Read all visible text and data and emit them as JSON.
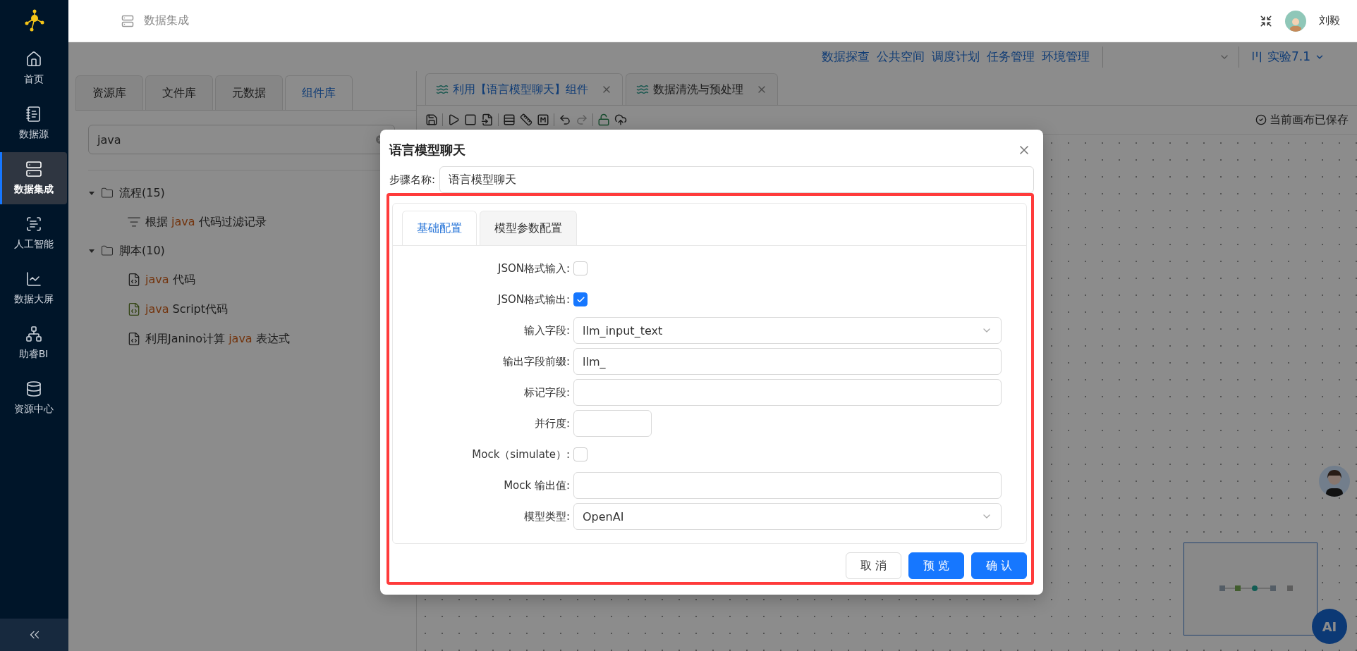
{
  "sidebar": {
    "items": [
      {
        "label": "首页",
        "selected": false
      },
      {
        "label": "数据源",
        "selected": false
      },
      {
        "label": "数据集成",
        "selected": true
      },
      {
        "label": "人工智能",
        "selected": false
      },
      {
        "label": "数据大屏",
        "selected": false
      },
      {
        "label": "助睿BI",
        "selected": false
      },
      {
        "label": "资源中心",
        "selected": false
      }
    ]
  },
  "header": {
    "title": "数据集成",
    "user": "刘毅"
  },
  "nav": {
    "links": [
      "数据探查",
      "公共空间",
      "调度计划",
      "任务管理",
      "环境管理"
    ],
    "project": "实验7.1"
  },
  "left_panel": {
    "tabs": [
      {
        "label": "资源库",
        "selected": false
      },
      {
        "label": "文件库",
        "selected": false
      },
      {
        "label": "元数据",
        "selected": false
      },
      {
        "label": "组件库",
        "selected": true
      }
    ],
    "search": {
      "value": "java"
    },
    "tree": [
      {
        "label": "流程(15)",
        "expanded": true,
        "children": [
          {
            "kind": "filter",
            "prefix": "根据 ",
            "match": "java",
            "suffix": " 代码过滤记录"
          }
        ]
      },
      {
        "label": "脚本(10)",
        "expanded": true,
        "children": [
          {
            "kind": "script",
            "match": "java",
            "suffix": " 代码"
          },
          {
            "kind": "js",
            "match": "java",
            "suffix": " Script代码"
          },
          {
            "kind": "script",
            "prefix": "利用Janino计算 ",
            "match": "java",
            "suffix": " 表达式"
          }
        ]
      }
    ]
  },
  "editor": {
    "tabs": [
      {
        "label": "利用【语言模型聊天】组件",
        "selected": true
      },
      {
        "label": "数据清洗与预处理",
        "selected": false
      }
    ],
    "status": "当前画布已保存",
    "ai_button": "AI"
  },
  "dialog": {
    "title": "语言模型聊天",
    "step_name_label": "步骤名称:",
    "step_name": "语言模型聊天",
    "tabs": [
      {
        "label": "基础配置",
        "selected": true
      },
      {
        "label": "模型参数配置",
        "selected": false
      }
    ],
    "fields": [
      {
        "kind": "checkbox",
        "label": "JSON格式输入:",
        "checked": false
      },
      {
        "kind": "checkbox",
        "label": "JSON格式输出:",
        "checked": true
      },
      {
        "kind": "select",
        "label": "输入字段:",
        "value": "llm_input_text"
      },
      {
        "kind": "input",
        "label": "输出字段前缀:",
        "value": "llm_"
      },
      {
        "kind": "input",
        "label": "标记字段:"
      },
      {
        "kind": "short_input",
        "label": "并行度:"
      },
      {
        "kind": "checkbox",
        "label": "Mock（simulate）:",
        "checked": false
      },
      {
        "kind": "input",
        "label": "Mock 输出值:"
      },
      {
        "kind": "select",
        "label": "模型类型:",
        "value": "OpenAI"
      }
    ],
    "buttons": [
      {
        "label": "取 消",
        "kind": "default"
      },
      {
        "label": "预 览",
        "kind": "primary"
      },
      {
        "label": "确 认",
        "kind": "primary"
      }
    ]
  }
}
